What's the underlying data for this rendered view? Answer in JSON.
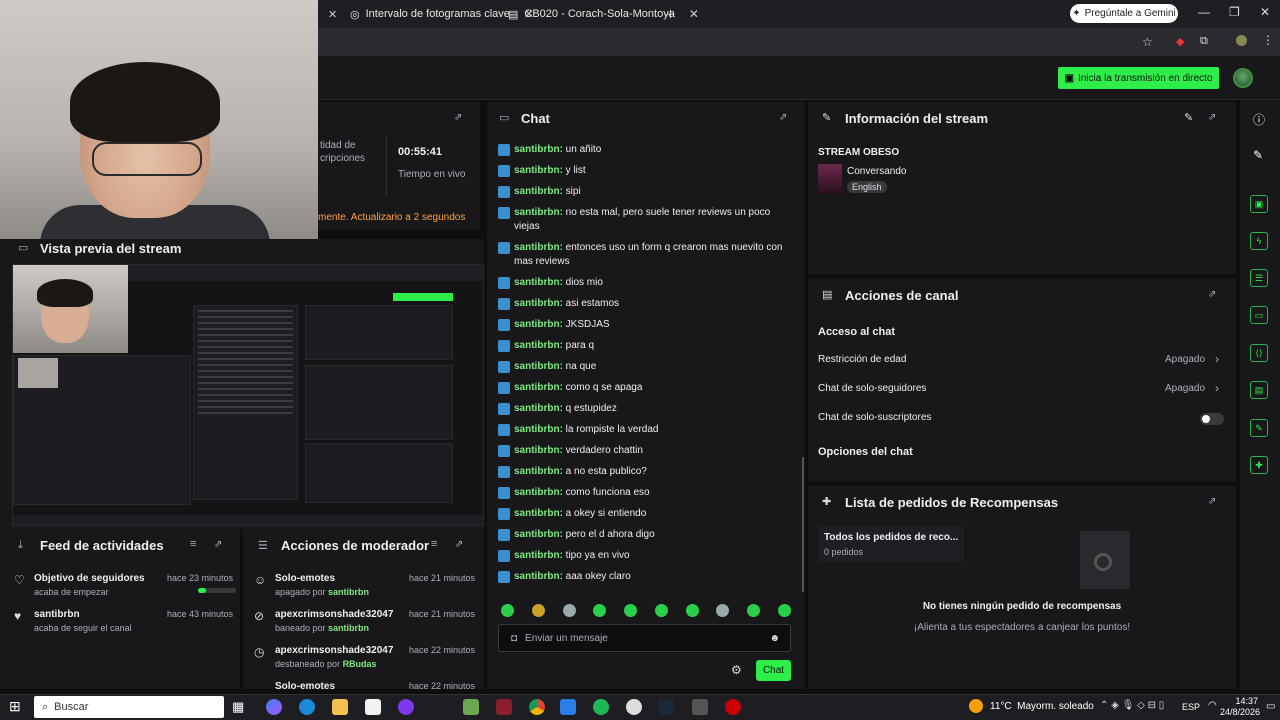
{
  "browser": {
    "tabs": [
      {
        "label": "Intervalo de fotogramas clave"
      },
      {
        "label": "CB020 - Corach-Sola-Montoya"
      }
    ],
    "gemini_label": "Pregúntale a Gemini"
  },
  "topbar": {
    "go_live_label": "Inicia la transmisión en directo"
  },
  "stats": {
    "time_value": "00:55:41",
    "time_label": "Tiempo en vivo",
    "subs_label": "tidad de cripciones",
    "update_notice": "mente. Actualizario a 2 segundos"
  },
  "preview": {
    "title": "Vista previa del stream"
  },
  "chat": {
    "title": "Chat",
    "messages": [
      {
        "user": "santibrbn",
        "text": "un añito"
      },
      {
        "user": "santibrbn",
        "text": "y list"
      },
      {
        "user": "santibrbn",
        "text": "sipi"
      },
      {
        "user": "santibrbn",
        "text": "no esta mal, pero suele tener reviews un poco viejas"
      },
      {
        "user": "santibrbn",
        "text": "entonces uso un form q crearon mas nuevito con mas reviews"
      },
      {
        "user": "santibrbn",
        "text": "dios mio"
      },
      {
        "user": "santibrbn",
        "text": "asi estamos"
      },
      {
        "user": "santibrbn",
        "text": "JKSDJAS"
      },
      {
        "user": "santibrbn",
        "text": "para q"
      },
      {
        "user": "santibrbn",
        "text": "na que"
      },
      {
        "user": "santibrbn",
        "text": "como q se apaga"
      },
      {
        "user": "santibrbn",
        "text": "q estupidez"
      },
      {
        "user": "santibrbn",
        "text": "la rompiste la verdad"
      },
      {
        "user": "santibrbn",
        "text": "verdadero chattin"
      },
      {
        "user": "santibrbn",
        "text": "a no esta publico?"
      },
      {
        "user": "santibrbn",
        "text": "como funciona eso"
      },
      {
        "user": "santibrbn",
        "text": "a okey si entiendo"
      },
      {
        "user": "santibrbn",
        "text": "pero el d ahora digo"
      },
      {
        "user": "santibrbn",
        "text": "tipo ya en vivo"
      },
      {
        "user": "santibrbn",
        "text": "aaa okey claro"
      }
    ],
    "input_placeholder": "Enviar un mensaje",
    "send_label": "Chat"
  },
  "stream_info": {
    "title": "Información del stream",
    "stream_title": "STREAM OBESO",
    "category": "Conversando",
    "language": "English"
  },
  "channel_actions": {
    "title": "Acciones de canal",
    "section": "Acceso al chat",
    "rows": [
      {
        "label": "Restricción de edad",
        "value": "Apagado"
      },
      {
        "label": "Chat de solo-seguidores",
        "value": "Apagado"
      },
      {
        "label": "Chat de solo-suscriptores",
        "value": ""
      }
    ],
    "options_label": "Opciones del chat"
  },
  "rewards": {
    "title": "Lista de pedidos de Recompensas",
    "all_label": "Todos los pedidos de reco...",
    "count": "0 pedidos",
    "empty_title": "No tienes ningún pedido de recompensas",
    "empty_sub": "¡Alienta a tus espectadores a canjear los puntos!"
  },
  "feed": {
    "title": "Feed de actividades",
    "items": [
      {
        "name": "Objetivo de seguidores",
        "sub": "acaba de empezar",
        "time": "hace 23 minutos",
        "progress": 0.2
      },
      {
        "name": "santibrbn",
        "sub": "acaba de seguir el canal",
        "time": "hace 43 minutos"
      }
    ]
  },
  "mod": {
    "title": "Acciones de moderador",
    "items": [
      {
        "name": "Solo-emotes",
        "action": "apagado por ",
        "by": "santibrbn",
        "time": "hace 21 minutos"
      },
      {
        "name": "apexcrimsonshade32047",
        "action": "baneado por ",
        "by": "santibrbn",
        "time": "hace 21 minutos"
      },
      {
        "name": "apexcrimsonshade32047",
        "action": "desbaneado por ",
        "by": "RBudas",
        "time": "hace 22 minutos"
      },
      {
        "name": "Solo-emotes",
        "action": "",
        "by": "",
        "time": "hace 22 minutos"
      }
    ]
  },
  "taskbar": {
    "search_label": "Buscar",
    "weather": "11°C  Mayorm. soleado",
    "lang": "ESP",
    "time": "14:37",
    "date": "24/8/2026"
  },
  "colors": {
    "accent": "#2eef4a",
    "username": "#7ee881",
    "panel": "#18181b",
    "bg": "#0e0e10"
  }
}
